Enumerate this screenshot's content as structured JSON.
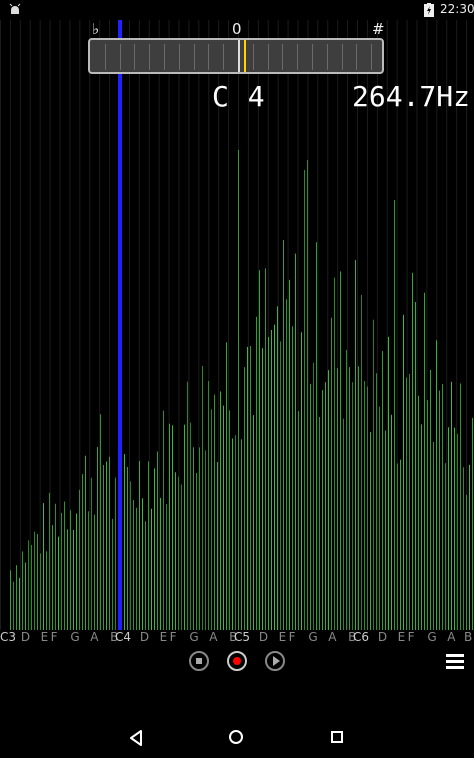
{
  "status_bar": {
    "time": "22:30",
    "left_icon": "android-debug-icon",
    "battery_icon": "battery-charging-icon"
  },
  "tuner": {
    "flat_label": "♭",
    "zero_label": "0",
    "sharp_label": "#",
    "needle_offset_fraction": 0.04,
    "needle_color": "#ffd400",
    "note": "C 4",
    "frequency": "264.7Hz"
  },
  "spectrum": {
    "bar_color": "#3fbf3f",
    "marker_color": "#2020ff",
    "marker_note": "C4"
  },
  "note_axis": [
    "C3",
    "D",
    "E",
    "F",
    "G",
    "A",
    "B",
    "C4",
    "D",
    "E",
    "F",
    "G",
    "A",
    "B",
    "C5",
    "D",
    "E",
    "F",
    "G",
    "A",
    "B",
    "C6",
    "D",
    "E",
    "F",
    "G",
    "A",
    "B"
  ],
  "controls": {
    "stop_icon": "stop-icon",
    "record_icon": "record-icon",
    "play_icon": "play-icon",
    "menu_icon": "menu-icon"
  },
  "nav_bar": {
    "back_icon": "back-icon",
    "home_icon": "home-icon",
    "recents_icon": "recents-icon"
  }
}
